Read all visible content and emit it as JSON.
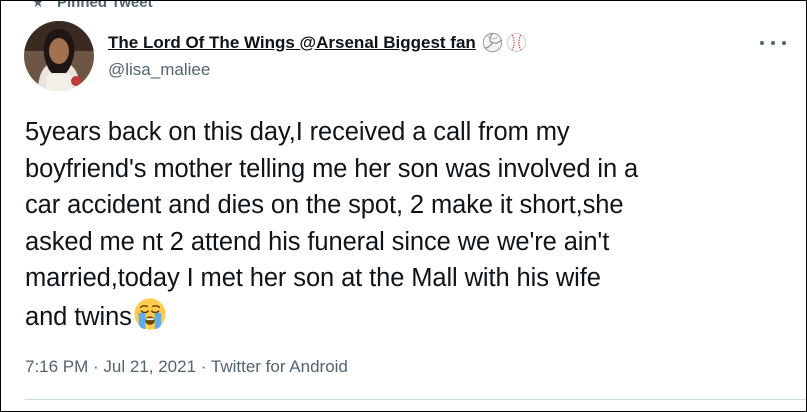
{
  "pinned": {
    "label": "Pinned Tweet",
    "icon": "pin-icon"
  },
  "author": {
    "display_name": "The Lord Of The Wings @Arsenal Biggest fan",
    "handle": "@lisa_maliee",
    "badges": [
      "volleyball-emoji-icon",
      "baseball-emoji-icon"
    ],
    "avatar": "avatar-photo"
  },
  "more_icon": "more-options-icon",
  "tweet": {
    "lines": [
      "5years back on this day,I received a call from my",
      "boyfriend's mother telling me her son was involved in a",
      "car accident and dies on the spot, 2 make it short,she",
      "asked me nt 2 attend his funeral since we we're ain't",
      "married,today I met her son at the Mall with his wife",
      "and twins"
    ],
    "emoji": "loudly-crying-face-emoji"
  },
  "meta": {
    "time": "7:16 PM",
    "separator": " · ",
    "date": "Jul 21, 2021",
    "source": "Twitter for Android"
  },
  "colors": {
    "text": "#0f1419",
    "secondary": "#536471",
    "divider": "#cfd9de"
  }
}
